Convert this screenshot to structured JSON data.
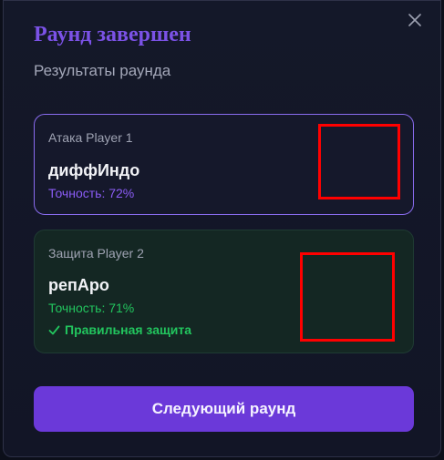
{
  "modal": {
    "title": "Раунд завершен",
    "subtitle": "Результаты раунда",
    "close_icon": "close-icon"
  },
  "attack": {
    "role": "Атака Player 1",
    "name": "диффИндо",
    "accuracy": "Точность: 72%",
    "accent_color": "#8b5cf6"
  },
  "defense": {
    "role": "Защита Player 2",
    "name": "репАро",
    "accuracy": "Точность: 71%",
    "status": "Правильная защита",
    "status_icon": "check-icon",
    "accent_color": "#22c55e"
  },
  "actions": {
    "next_label": "Следующий раунд",
    "button_color": "#6b39d9"
  }
}
